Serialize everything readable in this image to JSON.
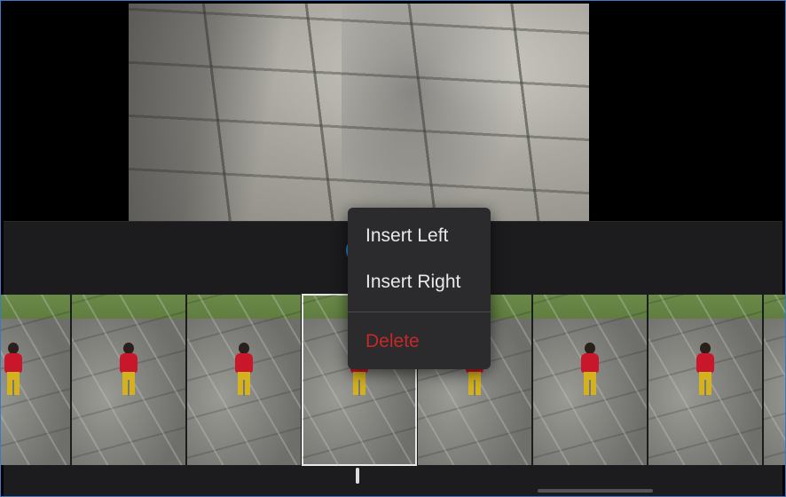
{
  "context_menu": {
    "insert_left": "Insert Left",
    "insert_right": "Insert Right",
    "delete": "Delete",
    "delete_color": "#c62828"
  },
  "accent_color": "#1e88d8",
  "timeline": {
    "frame_count": 7,
    "selected_index": 3
  }
}
